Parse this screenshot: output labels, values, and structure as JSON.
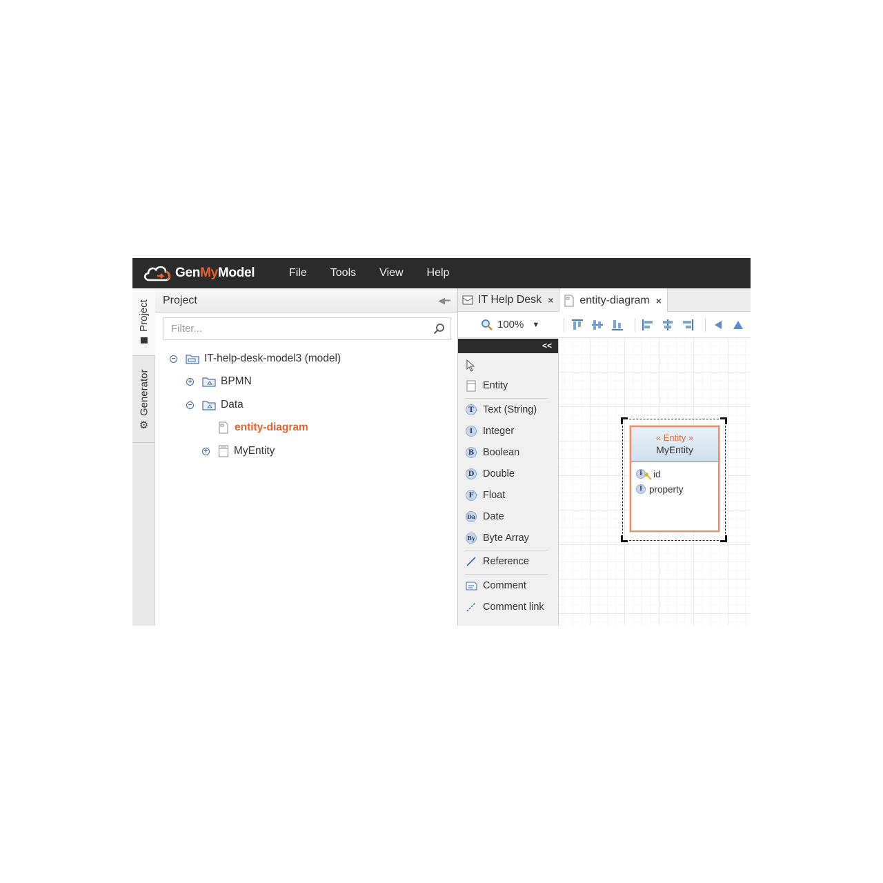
{
  "app": {
    "logo": {
      "prefix": "Gen",
      "accent": "My",
      "suffix": "Model"
    },
    "menu": [
      "File",
      "Tools",
      "View",
      "Help"
    ]
  },
  "side_tabs": {
    "project": "Project",
    "generator": "Generator"
  },
  "project_panel": {
    "title": "Project",
    "filter_placeholder": "Filter...",
    "tree": [
      {
        "label": "IT-help-desk-model3 (model)",
        "toggle": "−"
      },
      {
        "label": "BPMN",
        "toggle": "+"
      },
      {
        "label": "Data",
        "toggle": "−"
      },
      {
        "label": "entity-diagram",
        "active": true
      },
      {
        "label": "MyEntity",
        "toggle": "+"
      }
    ]
  },
  "editor": {
    "tabs": [
      {
        "label": "IT Help Desk",
        "close": "×"
      },
      {
        "label": "entity-diagram",
        "close": "×"
      }
    ],
    "zoom": "100%",
    "palette": {
      "collapse_label": "<<",
      "items": {
        "entity": "Entity",
        "text": "Text (String)",
        "integer": "Integer",
        "boolean": "Boolean",
        "double": "Double",
        "float": "Float",
        "date": "Date",
        "byte_array": "Byte Array",
        "reference": "Reference",
        "comment": "Comment",
        "comment_link": "Comment link"
      },
      "type_glyphs": {
        "text": "T",
        "integer": "I",
        "boolean": "B",
        "double": "D",
        "float": "F",
        "date": "Da",
        "byte_array": "By"
      }
    },
    "entity": {
      "stereotype": "« Entity »",
      "name": "MyEntity",
      "attributes": [
        "id",
        "property"
      ],
      "attribute_glyph": "I"
    }
  },
  "colors": {
    "accent": "#e8622c",
    "topbar": "#2b2b2b",
    "entity_border": "#f08a62"
  }
}
